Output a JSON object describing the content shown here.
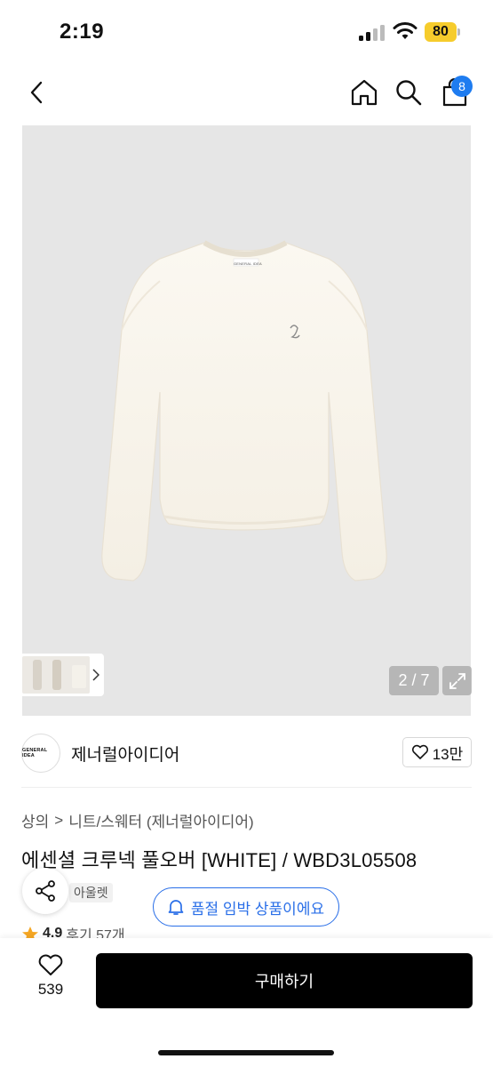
{
  "status_bar": {
    "time": "2:19",
    "battery": "80"
  },
  "nav": {
    "cart_count": "8"
  },
  "gallery": {
    "current": "2 / 7",
    "garment_brand_label": "GENERAL IDEA"
  },
  "brand": {
    "logo_text": "GENERAL IDEA",
    "name": "제너럴아이디어",
    "likes": "13만"
  },
  "breadcrumb": {
    "category": "상의",
    "separator": ">",
    "subcategory": "니트/스웨터 (제너럴아이디어)"
  },
  "product": {
    "title": "에센셜 크루넥 풀오버 [WHITE] / WBD3L05508",
    "tag": "아울렛",
    "low_stock_chip": "품절 임박 상품이에요",
    "rating": "4.9",
    "review_label": "후기 57개"
  },
  "bottom_bar": {
    "wish_count": "539",
    "buy_label": "구매하기"
  },
  "colors": {
    "accent_blue": "#2a6fe8",
    "badge_blue": "#1e7cf0",
    "star": "#f5a623",
    "buy_bg": "#000000"
  }
}
